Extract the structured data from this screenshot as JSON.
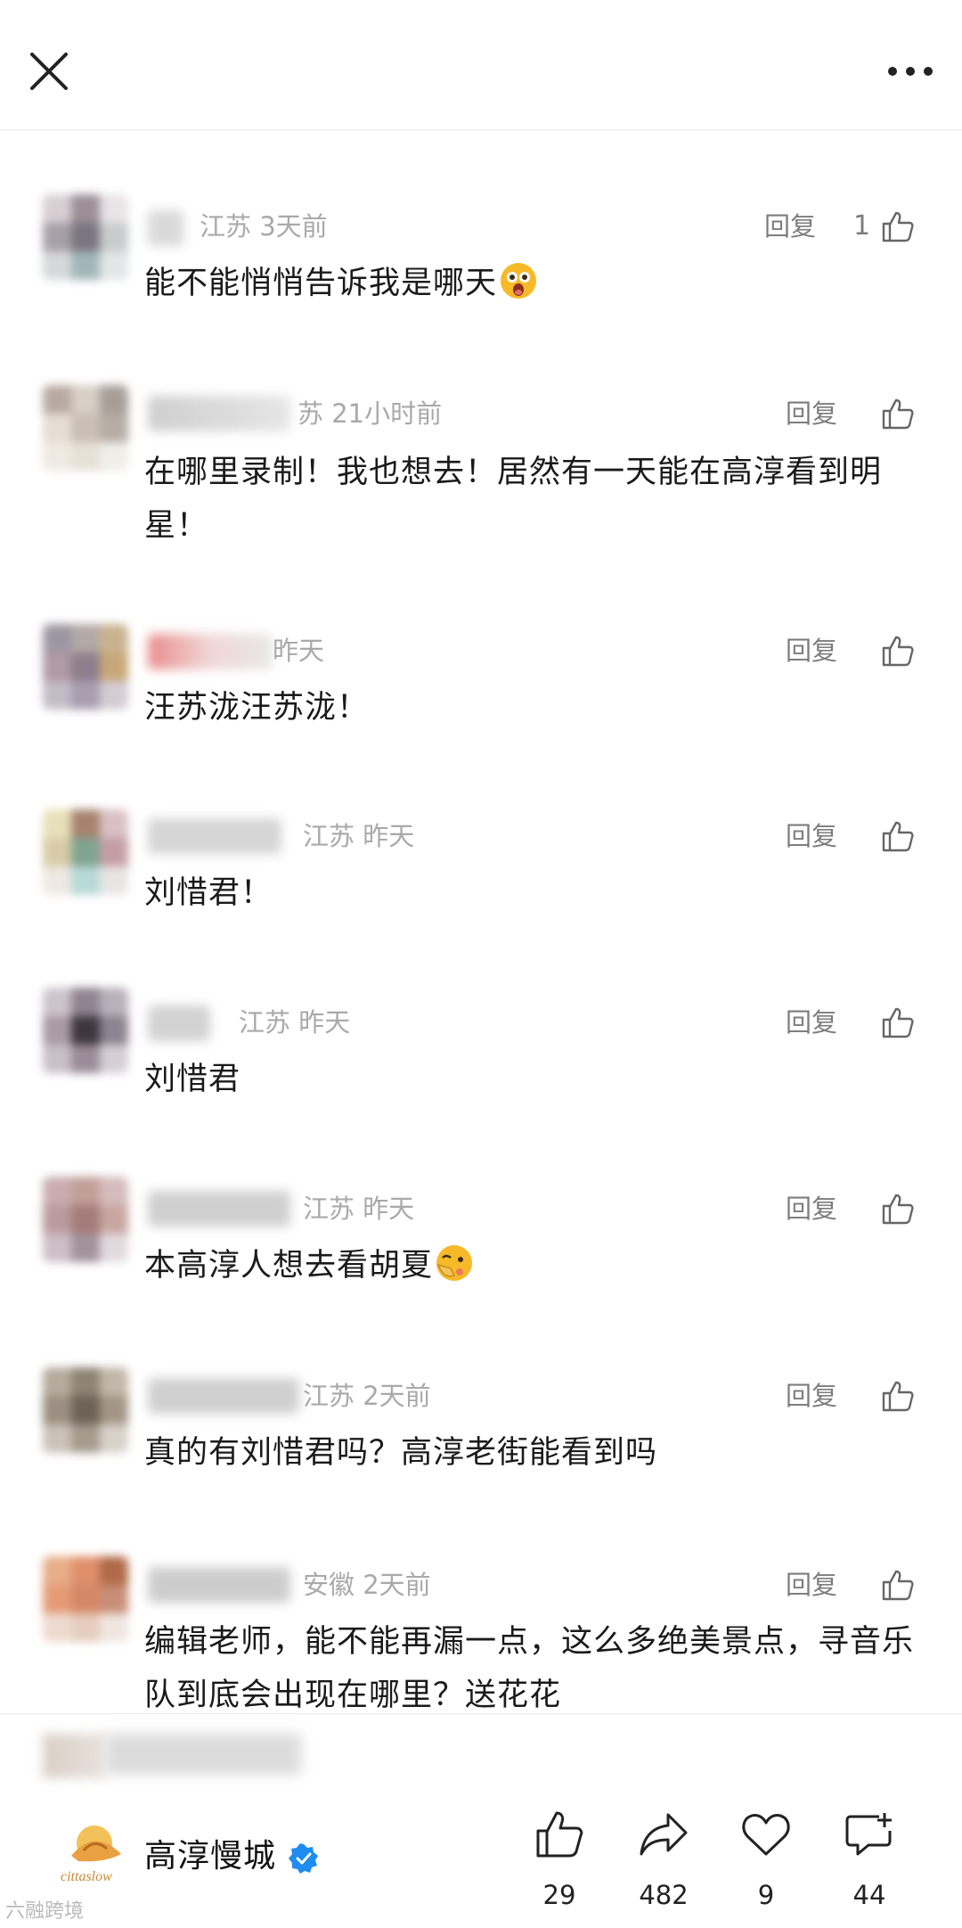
{
  "comments": [
    {
      "meta": "江苏 3天前",
      "reply": "回复",
      "likes": "1",
      "text": "能不能悄悄告诉我是哪天"
    },
    {
      "meta": "苏 21小时前",
      "reply": "回复",
      "likes": "",
      "text": "在哪里录制！我也想去！居然有一天能在高淳看到明星！"
    },
    {
      "meta": "昨天",
      "reply": "回复",
      "likes": "",
      "text": "汪苏泷汪苏泷！"
    },
    {
      "meta": "江苏 昨天",
      "reply": "回复",
      "likes": "",
      "text": "刘惜君！"
    },
    {
      "meta": "江苏 昨天",
      "reply": "回复",
      "likes": "",
      "text": "刘惜君"
    },
    {
      "meta": "江苏 昨天",
      "reply": "回复",
      "likes": "",
      "text": "本高淳人想去看胡夏"
    },
    {
      "meta": "江苏 2天前",
      "reply": "回复",
      "likes": "",
      "text": "真的有刘惜君吗？高淳老街能看到吗"
    },
    {
      "meta": "安徽 2天前",
      "reply": "回复",
      "likes": "",
      "text": "编辑老师，能不能再漏一点，这么多绝美景点，寻音乐队到底会出现在哪里？送花花"
    }
  ],
  "account": {
    "name": "高淳慢城",
    "logo_text": "cittaslow"
  },
  "actions": {
    "like_count": "29",
    "share_count": "482",
    "favorite_count": "9",
    "comment_count": "44"
  },
  "watermark": "六融跨境"
}
